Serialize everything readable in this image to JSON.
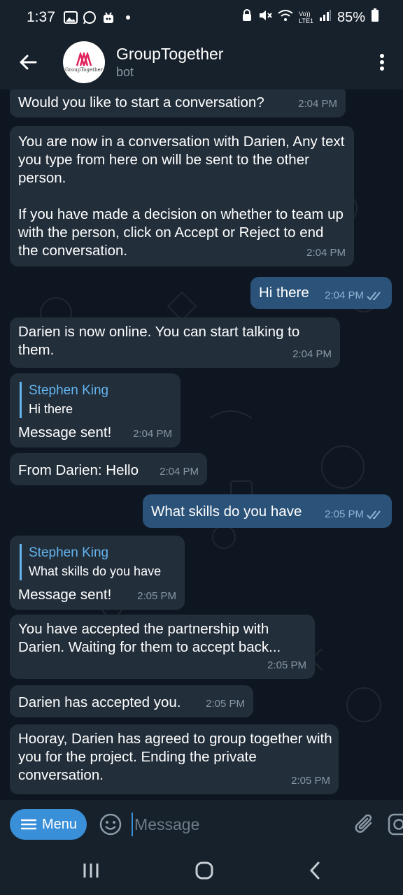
{
  "status_bar": {
    "time": "1:37",
    "network": "LTE1",
    "volte": "Vo))",
    "battery": "85%"
  },
  "header": {
    "title": "GroupTogether",
    "subtitle": "bot",
    "avatar_text": "GroupTogether"
  },
  "messages": [
    {
      "dir": "in",
      "text": "Would you like to start a conversation?",
      "time": "2:04 PM"
    },
    {
      "dir": "in",
      "text": "You are now in a conversation with Darien, Any text you type from here on will be sent to the other person.\n\nIf you have made a decision on whether to team up with the person, click on Accept or Reject to end the conversation.",
      "time": "2:04 PM"
    },
    {
      "dir": "out",
      "text": "Hi there",
      "time": "2:04 PM"
    },
    {
      "dir": "in",
      "text": "Darien is now online. You can start talking to them.",
      "time": "2:04 PM"
    },
    {
      "dir": "in",
      "reply_name": "Stephen King",
      "reply_text": "Hi there",
      "text": "Message sent!",
      "time": "2:04 PM"
    },
    {
      "dir": "in",
      "text": "From Darien: Hello",
      "time": "2:04 PM"
    },
    {
      "dir": "out",
      "text": "What skills do you have",
      "time": "2:05 PM"
    },
    {
      "dir": "in",
      "reply_name": "Stephen King",
      "reply_text": "What skills do you have",
      "text": "Message sent!",
      "time": "2:05 PM"
    },
    {
      "dir": "in",
      "text": "You have accepted the partnership with Darien. Waiting for them to accept back...",
      "time": "2:05 PM"
    },
    {
      "dir": "in",
      "text": "Darien has accepted you.",
      "time": "2:05 PM"
    },
    {
      "dir": "in",
      "text": "Hooray, Darien has agreed to group together with you for the project. Ending the private conversation.",
      "time": "2:05 PM"
    }
  ],
  "composer": {
    "menu_label": "Menu",
    "placeholder": "Message"
  },
  "colors": {
    "background": "#0e1621",
    "incoming_bubble": "#222e3a",
    "outgoing_bubble": "#2b5278",
    "accent": "#3a8fd9",
    "reply_accent": "#64b5ef"
  }
}
